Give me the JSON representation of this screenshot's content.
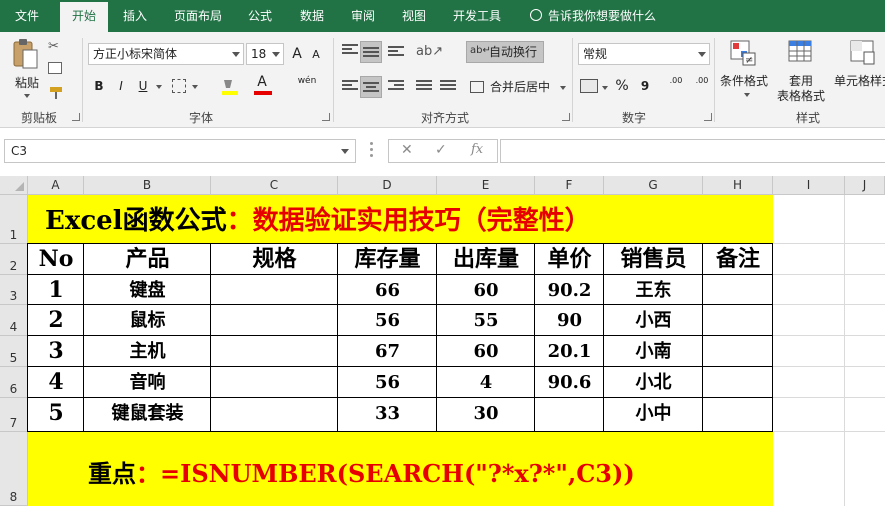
{
  "tabs": [
    "文件",
    "开始",
    "插入",
    "页面布局",
    "公式",
    "数据",
    "审阅",
    "视图",
    "开发工具"
  ],
  "active_tab": "开始",
  "tell_me": "告诉我你想要做什么",
  "ribbon": {
    "clipboard": {
      "paste": "粘贴",
      "label": "剪贴板"
    },
    "font": {
      "name": "方正小标宋简体",
      "size": "18",
      "grow": "A",
      "shrink": "A",
      "bold": "B",
      "italic": "I",
      "underline": "U",
      "font_color": "A",
      "phonetic": "wén",
      "label": "字体"
    },
    "alignment": {
      "wrap": "自动换行",
      "merge": "合并后居中",
      "label": "对齐方式"
    },
    "number": {
      "format": "常规",
      "percent": "%",
      "comma": "9",
      "inc_decimal": ".00",
      "dec_decimal": ".00",
      "label": "数字"
    },
    "styles": {
      "conditional": "条件格式",
      "table_line1": "套用",
      "table_line2": "表格格式",
      "cell_styles": "单元格样式",
      "label": "样式"
    }
  },
  "formula_bar": {
    "name_box": "C3",
    "cancel": "✕",
    "enter": "✓",
    "fx": "fx",
    "content": ""
  },
  "columns": [
    "A",
    "B",
    "C",
    "D",
    "E",
    "F",
    "G",
    "H",
    "I",
    "J"
  ],
  "rows": [
    "1",
    "2",
    "3",
    "4",
    "5",
    "6",
    "7",
    "8"
  ],
  "sheet": {
    "title_black": "Excel函数公式",
    "title_red": "：数据验证实用技巧（完整性）",
    "headers": [
      "No",
      "产品",
      "规格",
      "库存量",
      "出库量",
      "单价",
      "销售员",
      "备注"
    ],
    "rows": [
      [
        "1",
        "键盘",
        "",
        "66",
        "60",
        "90.2",
        "王东",
        ""
      ],
      [
        "2",
        "鼠标",
        "",
        "56",
        "55",
        "90",
        "小西",
        ""
      ],
      [
        "3",
        "主机",
        "",
        "67",
        "60",
        "20.1",
        "小南",
        ""
      ],
      [
        "4",
        "音响",
        "",
        "56",
        "4",
        "90.6",
        "小北",
        ""
      ],
      [
        "5",
        "键鼠套装",
        "",
        "33",
        "30",
        "",
        "小中",
        ""
      ]
    ],
    "note_black": "重点",
    "note_red": "：=ISNUMBER(SEARCH(\"?*x?*\",C3))"
  }
}
